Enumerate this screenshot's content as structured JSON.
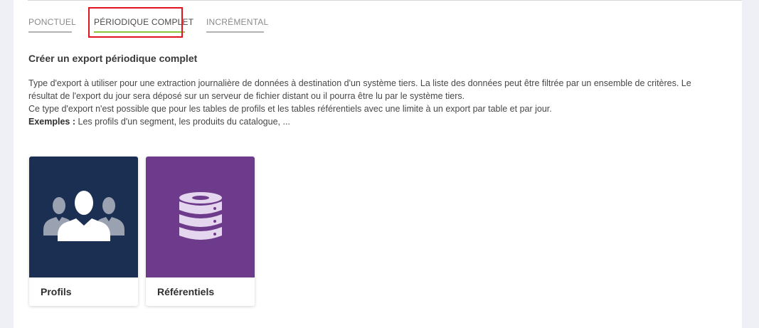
{
  "tabs": [
    {
      "label": "PONCTUEL",
      "active": false
    },
    {
      "label": "PÉRIODIQUE COMPLET",
      "active": true
    },
    {
      "label": "INCRÉMENTAL",
      "active": false
    }
  ],
  "section": {
    "title": "Créer un export périodique complet",
    "description_line1": "Type d'export à utiliser pour une extraction journalière de données à destination d'un système tiers. La liste des données peut être filtrée par un ensemble de critères. Le résultat de l'export du jour sera déposé sur un serveur de fichier distant ou il pourra être lu par le système tiers.",
    "description_line2": "Ce type d'export n'est possible que pour les tables de profils et les tables référentiels avec une limite à un export par table et par jour.",
    "examples_label": "Exemples :",
    "examples_text": " Les profils d'un segment, les produits du catalogue, ..."
  },
  "cards": [
    {
      "label": "Profils",
      "icon": "users-group-icon",
      "color": "#1b2f52"
    },
    {
      "label": "Référentiels",
      "icon": "database-icon",
      "color": "#6e3b8c"
    }
  ],
  "colors": {
    "active_tab_underline": "#8cc63f",
    "highlight_box": "#e0141e"
  }
}
